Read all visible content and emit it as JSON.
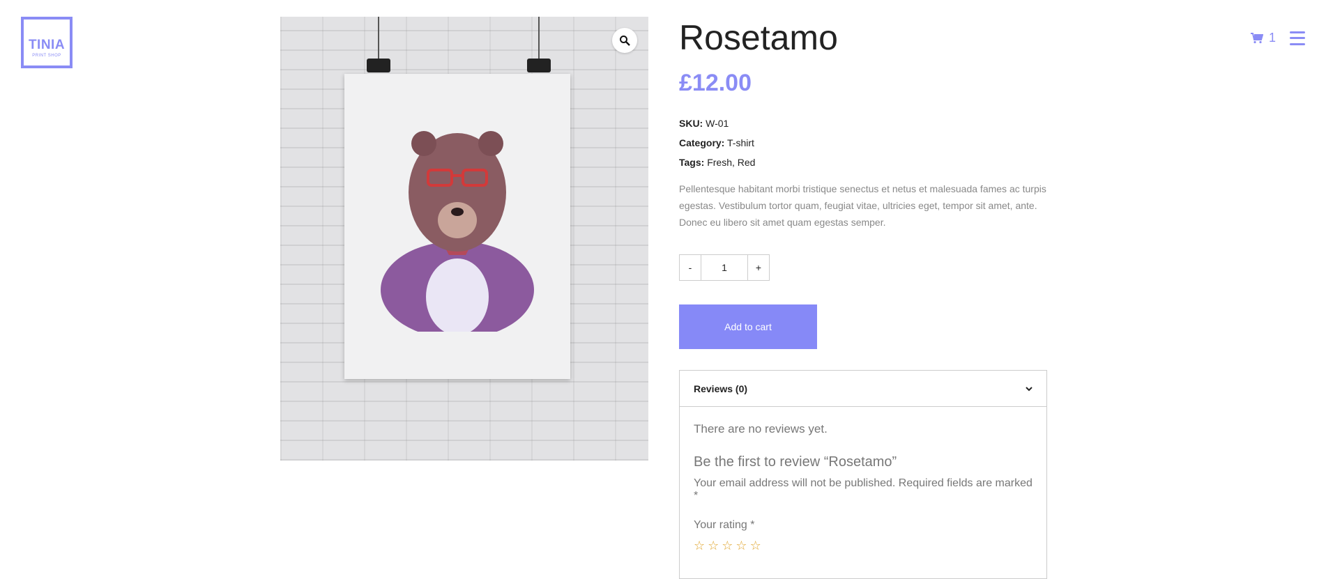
{
  "brand": {
    "name": "TINIA",
    "tagline": "PRINT SHOP"
  },
  "header": {
    "cart_count": "1"
  },
  "product": {
    "title": "Rosetamo",
    "price": "£12.00",
    "sku_label": "SKU:",
    "sku": "W-01",
    "category_label": "Category:",
    "category": "T-shirt",
    "tags_label": "Tags:",
    "tags": [
      "Fresh",
      "Red"
    ],
    "tags_sep": ", ",
    "description": "Pellentesque habitant morbi tristique senectus et netus et malesuada fames ac turpis egestas. Vestibulum tortor quam, feugiat vitae, ultricies eget, tempor sit amet, ante. Donec eu libero sit amet quam egestas semper.",
    "quantity": {
      "minus": "-",
      "value": "1",
      "plus": "+"
    },
    "add_to_cart": "Add to cart"
  },
  "reviews": {
    "tab_label": "Reviews (0)",
    "none": "There are no reviews yet.",
    "first": "Be the first to review “Rosetamo”",
    "notice": "Your email address will not be published. Required fields are marked *",
    "rating_label": "Your rating *",
    "stars": [
      "☆",
      "☆",
      "☆",
      "☆",
      "☆"
    ]
  },
  "colors": {
    "accent": "#8a8cf5",
    "button": "#8689f7",
    "stars": "#e0a52e"
  },
  "icons": {
    "cart": "cart-icon",
    "menu": "hamburger-icon",
    "zoom": "magnifier-icon",
    "chevron": "chevron-down-icon"
  }
}
